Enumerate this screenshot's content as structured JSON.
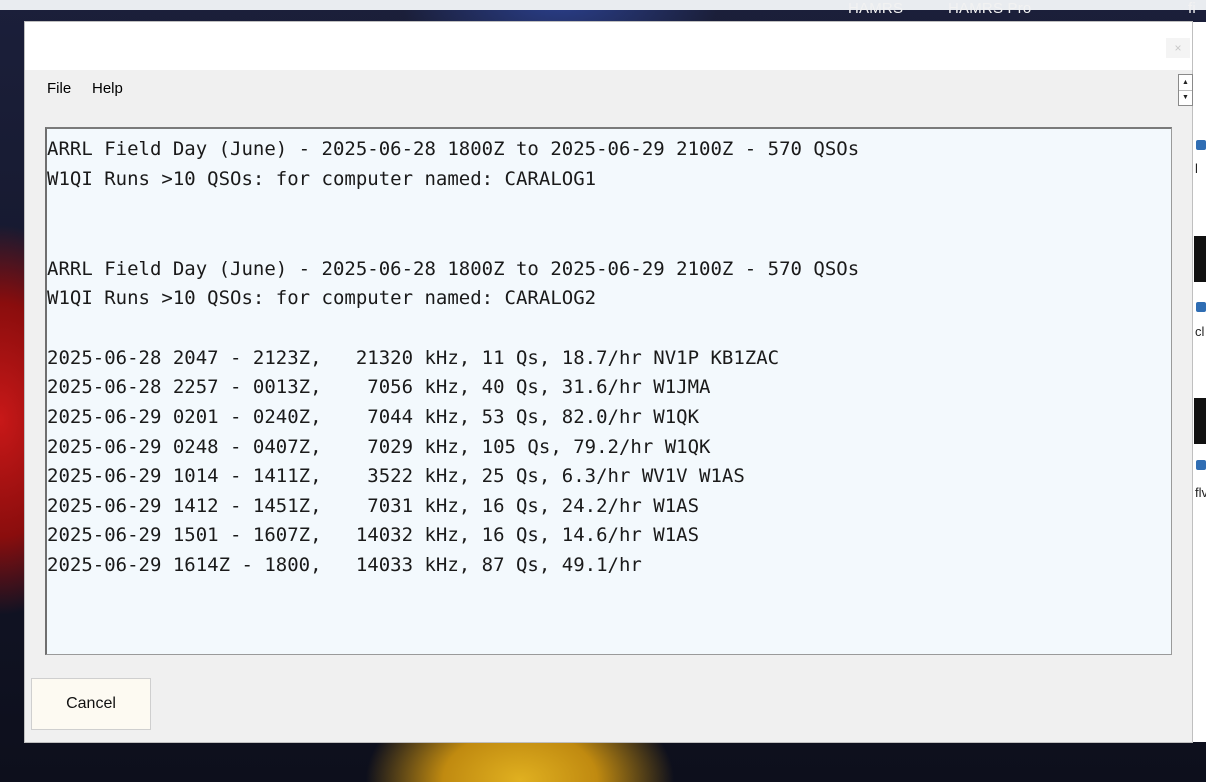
{
  "taskbar": {
    "items": [
      "HAMRS",
      "HAMRS Pro",
      "fi"
    ]
  },
  "menubar": {
    "file_label": "File",
    "help_label": "Help"
  },
  "spinner": {
    "up_label": "▲",
    "down_label": "▼"
  },
  "side_panel": {
    "labels": [
      "l",
      "cl",
      "flv"
    ]
  },
  "report": {
    "lines": [
      "ARRL Field Day (June) - 2025-06-28 1800Z to 2025-06-29 2100Z - 570 QSOs",
      "W1QI Runs >10 QSOs: for computer named: CARALOG1",
      "",
      "",
      "ARRL Field Day (June) - 2025-06-28 1800Z to 2025-06-29 2100Z - 570 QSOs",
      "W1QI Runs >10 QSOs: for computer named: CARALOG2",
      "",
      "2025-06-28 2047 - 2123Z,   21320 kHz, 11 Qs, 18.7/hr NV1P KB1ZAC",
      "2025-06-28 2257 - 0013Z,    7056 kHz, 40 Qs, 31.6/hr W1JMA",
      "2025-06-29 0201 - 0240Z,    7044 kHz, 53 Qs, 82.0/hr W1QK",
      "2025-06-29 0248 - 0407Z,    7029 kHz, 105 Qs, 79.2/hr W1QK",
      "2025-06-29 1014 - 1411Z,    3522 kHz, 25 Qs, 6.3/hr WV1V W1AS",
      "2025-06-29 1412 - 1451Z,    7031 kHz, 16 Qs, 24.2/hr W1AS",
      "2025-06-29 1501 - 1607Z,   14032 kHz, 16 Qs, 14.6/hr W1AS",
      "2025-06-29 1614Z - 1800,   14033 kHz, 87 Qs, 49.1/hr"
    ]
  },
  "buttons": {
    "cancel_label": "Cancel"
  }
}
